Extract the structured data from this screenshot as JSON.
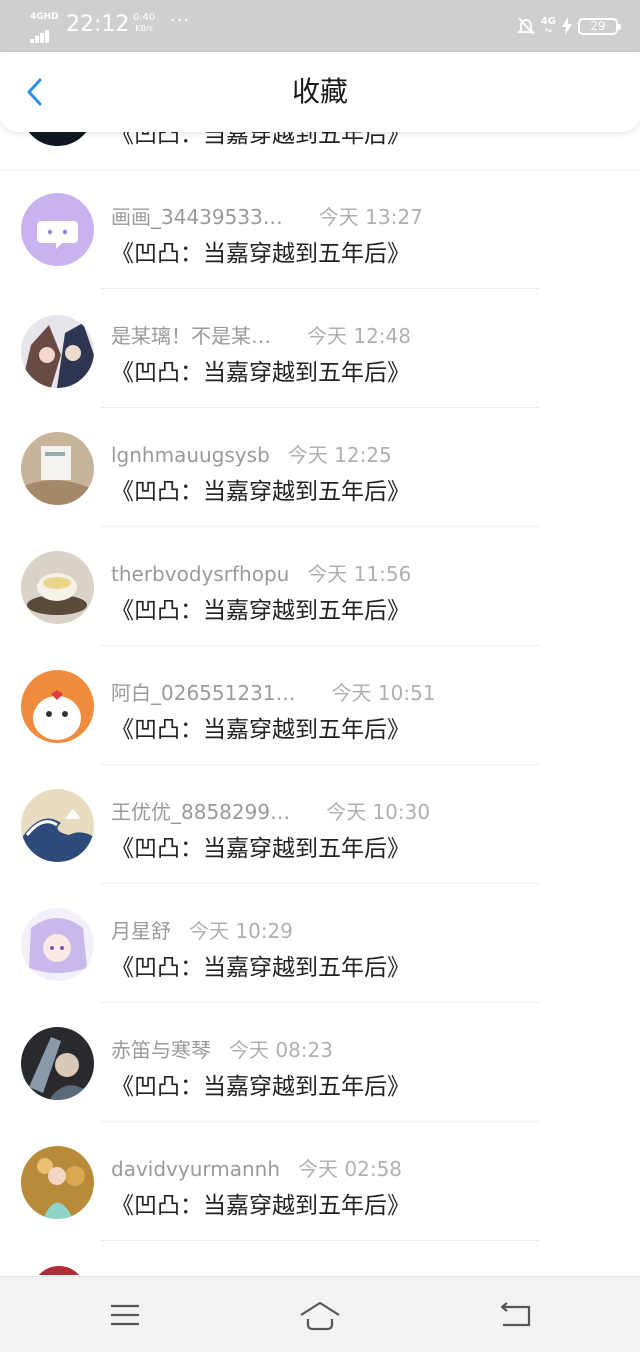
{
  "status_bar": {
    "network_label": "4GHD",
    "time": "22:12",
    "speed_value": "0.40",
    "speed_unit": "KB/s",
    "dots": "···",
    "network_right": "4G",
    "battery": "29"
  },
  "header": {
    "title": "收藏",
    "back_icon": "chevron-left-icon",
    "accent_color": "#2d8cf0"
  },
  "list": {
    "items": [
      {
        "name": "",
        "time": "",
        "title": "《凹凸：当嘉穿越到五年后》",
        "avatar": "partial"
      },
      {
        "name": "画画_34439533…",
        "time": "今天 13:27",
        "title": "《凹凸：当嘉穿越到五年后》",
        "avatar": "chat-bubble"
      },
      {
        "name": "是某璃！不是某…",
        "time": "今天 12:48",
        "title": "《凹凸：当嘉穿越到五年后》",
        "avatar": "anime-duo"
      },
      {
        "name": "lgnhmauugsysb",
        "time": "今天 12:25",
        "title": "《凹凸：当嘉穿越到五年后》",
        "avatar": "bag-photo"
      },
      {
        "name": "therbvodysrfhopu",
        "time": "今天 11:56",
        "title": "《凹凸：当嘉穿越到五年后》",
        "avatar": "pudding-cup"
      },
      {
        "name": "阿白_026551231…",
        "time": "今天 10:51",
        "title": "《凹凸：当嘉穿越到五年后》",
        "avatar": "cartoon-dog"
      },
      {
        "name": "王优优_8858299…",
        "time": "今天 10:30",
        "title": "《凹凸：当嘉穿越到五年后》",
        "avatar": "great-wave"
      },
      {
        "name": "月星舒",
        "time": "今天 10:29",
        "title": "《凹凸：当嘉穿越到五年后》",
        "avatar": "anime-girl"
      },
      {
        "name": "赤笛与寒琴",
        "time": "今天 08:23",
        "title": "《凹凸：当嘉穿越到五年后》",
        "avatar": "dark-anime"
      },
      {
        "name": "davidvyurmannh",
        "time": "今天 02:58",
        "title": "《凹凸：当嘉穿越到五年后》",
        "avatar": "girl-photo"
      }
    ]
  },
  "nav_bar": {
    "menu_icon": "menu-icon",
    "home_icon": "home-icon",
    "back_icon": "back-icon"
  }
}
